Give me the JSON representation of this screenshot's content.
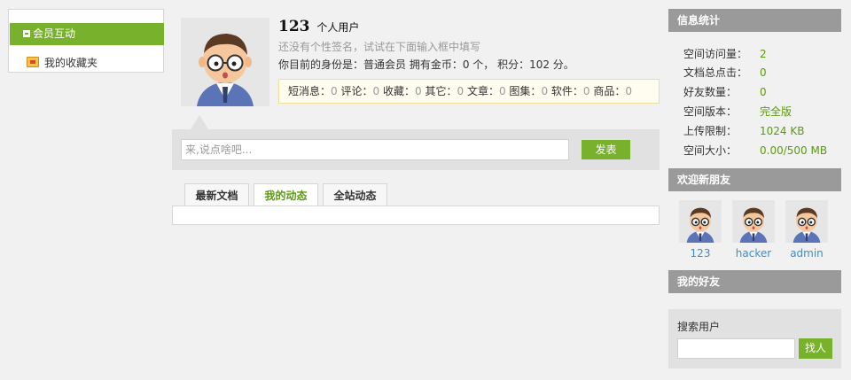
{
  "sidebar": {
    "items": [
      {
        "label": "会员互动",
        "icon": "minus-icon",
        "active": true
      },
      {
        "label": "我的收藏夹",
        "icon": "folder-icon",
        "active": false
      }
    ]
  },
  "profile": {
    "username": "123",
    "user_type": "个人用户",
    "signature_hint": "还没有个性签名，试试在下面输入框中填写",
    "identity_line": "你目前的身份是：普通会员 拥有金币：0 个， 积分：102 分。",
    "stats": [
      {
        "label": "短消息：",
        "value": "0"
      },
      {
        "label": "评论：",
        "value": "0"
      },
      {
        "label": "收藏：",
        "value": "0"
      },
      {
        "label": "其它：",
        "value": "0"
      },
      {
        "label": "文章：",
        "value": "0"
      },
      {
        "label": "图集：",
        "value": "0"
      },
      {
        "label": "软件：",
        "value": "0"
      },
      {
        "label": "商品：",
        "value": "0"
      }
    ]
  },
  "status": {
    "placeholder": "来,说点啥吧...",
    "post_label": "发表"
  },
  "tabs": [
    {
      "label": "最新文档",
      "active": false
    },
    {
      "label": "我的动态",
      "active": true
    },
    {
      "label": "全站动态",
      "active": false
    }
  ],
  "info": {
    "title": "信息统计",
    "rows": [
      {
        "key": "空间访问量：",
        "value": "2"
      },
      {
        "key": "文档总点击：",
        "value": "0"
      },
      {
        "key": "好友数量：",
        "value": "0"
      },
      {
        "key": "空间版本：",
        "value": "完全版"
      },
      {
        "key": "上传限制：",
        "value": "1024 KB"
      },
      {
        "key": "空间大小：",
        "value": "0.00/500 MB"
      }
    ]
  },
  "new_friends": {
    "title": "欢迎新朋友",
    "users": [
      "123",
      "hacker",
      "admin"
    ]
  },
  "my_friends": {
    "title": "我的好友"
  },
  "user_search": {
    "label": "搜索用户",
    "button_label": "找人"
  },
  "colors": {
    "accent_green": "#78b22c",
    "header_gray": "#9a9a9a",
    "link_blue": "#3a8fc9"
  }
}
